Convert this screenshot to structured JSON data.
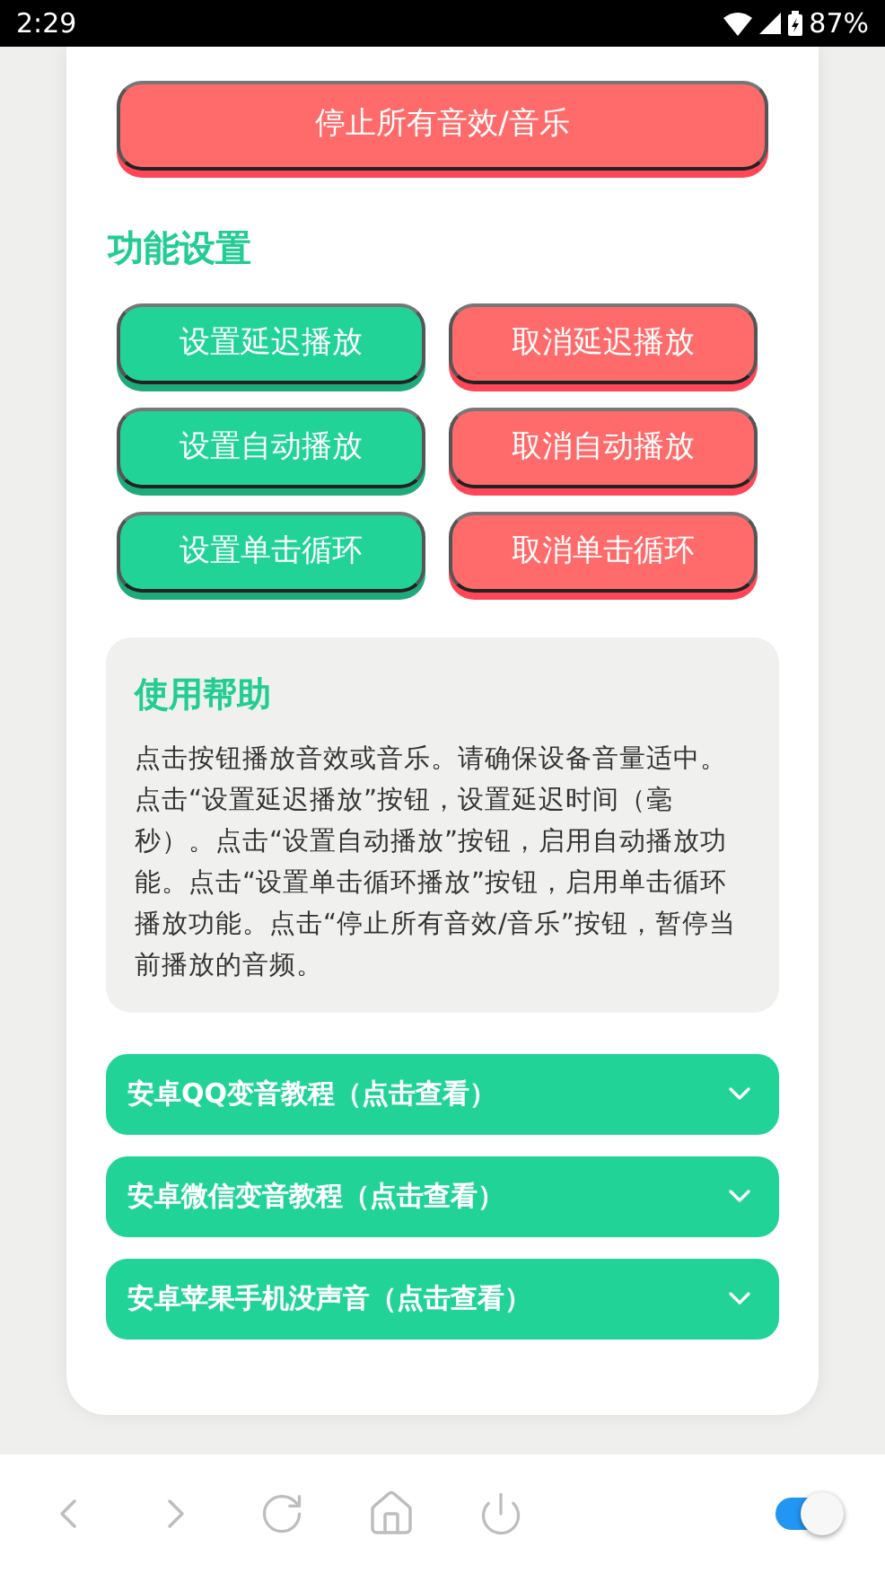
{
  "status_bar": {
    "time": "2:29",
    "battery": "87%"
  },
  "stop_button": {
    "label": "停止所有音效/音乐",
    "kind": "danger"
  },
  "settings": {
    "title": "功能设置",
    "buttons": [
      {
        "label": "设置延迟播放",
        "kind": "primary"
      },
      {
        "label": "取消延迟播放",
        "kind": "danger"
      },
      {
        "label": "设置自动播放",
        "kind": "primary"
      },
      {
        "label": "取消自动播放",
        "kind": "danger"
      },
      {
        "label": "设置单击循环",
        "kind": "primary"
      },
      {
        "label": "取消单击循环",
        "kind": "danger"
      }
    ]
  },
  "help": {
    "title": "使用帮助",
    "text": "点击按钮播放音效或音乐。请确保设备音量适中。点击“设置延迟播放”按钮，设置延迟时间（毫秒）。点击“设置自动播放”按钮，启用自动播放功能。点击“设置单击循环播放”按钮，启用单击循环播放功能。点击“停止所有音效/音乐”按钮，暂停当前播放的音频。"
  },
  "accordions": [
    {
      "label": "安卓QQ变音教程（点击查看）",
      "expanded": false
    },
    {
      "label": "安卓微信变音教程（点击查看）",
      "expanded": false
    },
    {
      "label": "安卓苹果手机没声音（点击查看）",
      "expanded": false
    }
  ],
  "browser_bar": {
    "toggle": {
      "on": true
    }
  }
}
